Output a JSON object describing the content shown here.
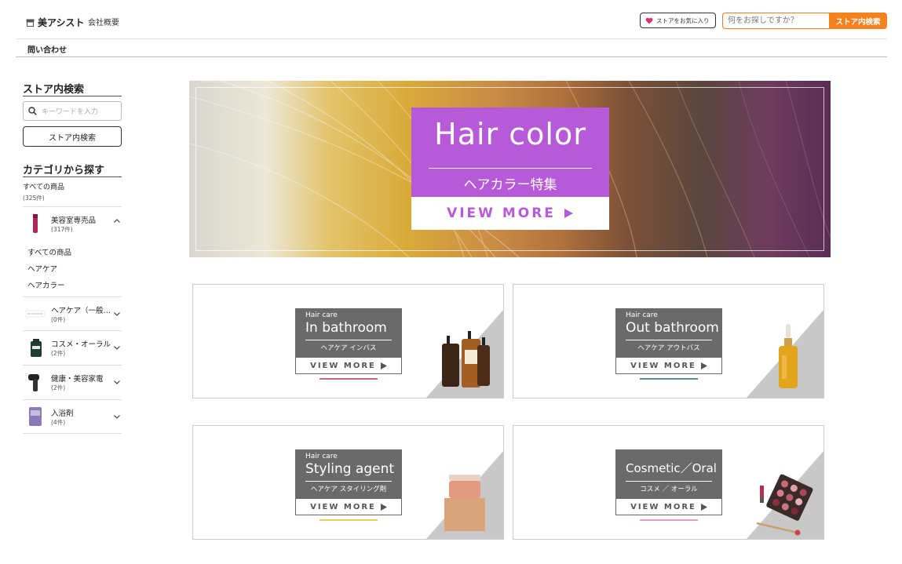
{
  "header": {
    "brand": "美アシスト",
    "about": "会社概要",
    "favorite": "ストアをお気に入り",
    "search_placeholder": "何をお探しですか？",
    "search_button": "ストア内検索",
    "contact": "問い合わせ"
  },
  "sidebar": {
    "search_title": "ストア内検索",
    "search_placeholder": "キーワードを入力",
    "search_button": "ストア内検索",
    "category_title": "カテゴリから探す",
    "all_label": "すべての商品",
    "all_count": "(325件)",
    "categories": [
      {
        "name": "美容室専売品",
        "count": "(317件)",
        "expanded": true
      },
      {
        "name": "ヘアケア（一般…",
        "count": "(0件)",
        "expanded": false
      },
      {
        "name": "コスメ・オーラル",
        "count": "(2件)",
        "expanded": false
      },
      {
        "name": "健康・美容家電",
        "count": "(2件)",
        "expanded": false
      },
      {
        "name": "入浴剤",
        "count": "(4件)",
        "expanded": false
      }
    ],
    "subcategories": [
      "すべての商品",
      "ヘアケア",
      "ヘアカラー"
    ]
  },
  "hero": {
    "title": "Hair color",
    "subtitle": "ヘアカラー特集",
    "cta": "VIEW MORE",
    "accent": "#b75ad8"
  },
  "cards": [
    {
      "category": "Hair care",
      "title": "In bathroom",
      "sub": "ヘアケア インバス",
      "cta": "VIEW MORE",
      "underline": "#c96a78"
    },
    {
      "category": "Hair care",
      "title": "Out bathroom",
      "sub": "ヘアケア アウトバス",
      "cta": "VIEW MORE",
      "underline": "#5f8a92"
    },
    {
      "category": "Hair care",
      "title": "Styling agent",
      "sub": "ヘアケア スタイリング剤",
      "cta": "VIEW MORE",
      "underline": "#e6d25a"
    },
    {
      "category": "",
      "title": "Cosmetic／Oral",
      "sub": "コスメ ／ オーラル",
      "cta": "VIEW MORE",
      "underline": "#e49ccb"
    }
  ],
  "colors": {
    "orange": "#f5811f",
    "heart": "#d6336c"
  }
}
